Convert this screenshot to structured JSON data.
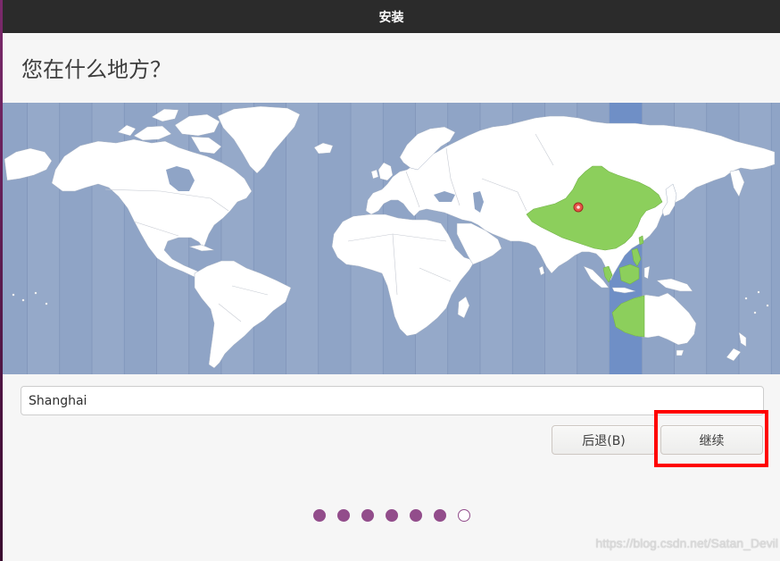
{
  "window": {
    "title": "安装"
  },
  "page": {
    "heading": "您在什么地方？"
  },
  "timezone_map": {
    "marker_icon": "location-pin-icon"
  },
  "location": {
    "value": "Shanghai"
  },
  "buttons": {
    "back_label": "后退(B)",
    "continue_label": "继续"
  },
  "progress": {
    "steps_total": 7,
    "steps_filled": 6
  },
  "watermark": "https://blog.csdn.net/Satan_Devil",
  "colors": {
    "titlebar": "#2b2b2b",
    "window_background": "#f6f6f6",
    "ocean": "#8fa4c6",
    "selected_timezone_band": "#6f8fc6",
    "land": "#ffffff",
    "selected_region": "#8ccf5c",
    "location_pin": "#e8564a",
    "progress_dot": "#924d8b",
    "annotation_box": "#ff0000"
  }
}
